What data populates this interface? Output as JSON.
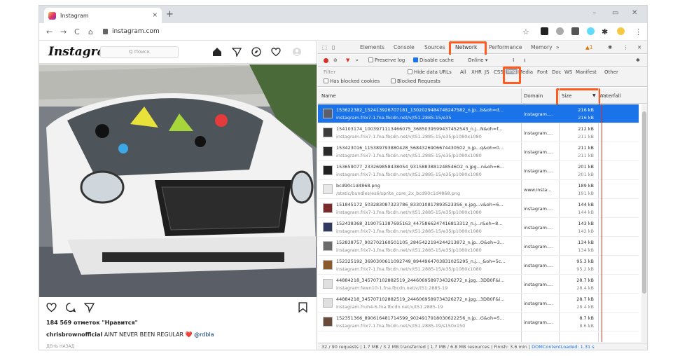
{
  "browser": {
    "tab_title": "Instagram",
    "tab_close": "×",
    "new_tab": "+",
    "url": "instagram.com",
    "win_minimize": "–",
    "win_restore": "▭",
    "win_close": "✕"
  },
  "instagram": {
    "logo": "Instagram",
    "search_placeholder": "Q Поиск",
    "likes": "184 569 отметок \"Нравится\"",
    "caption_user": "chrisbrownofficial",
    "caption_text": " AINT NEVER BEEN REGULAR ❤️ ",
    "caption_mention": "@rdbla",
    "time_ago": "ДЕНЬ НАЗАД"
  },
  "devtools": {
    "tabs": [
      "Elements",
      "Console",
      "Sources",
      "Network",
      "Performance",
      "Memory",
      "»"
    ],
    "warning_count": "▲1",
    "preserve_log": "Preserve log",
    "disable_cache": "Disable cache",
    "online": "Online",
    "filter_placeholder": "Filter",
    "hide_data_urls": "Hide data URLs",
    "type_filters": [
      "All",
      "XHR",
      "JS",
      "CSS",
      "Img",
      "Media",
      "Font",
      "Doc",
      "WS",
      "Manifest",
      "Other"
    ],
    "has_blocked_cookies": "Has blocked cookies",
    "blocked_requests": "Blocked Requests",
    "columns": {
      "name": "Name",
      "domain": "Domain",
      "size": "Size",
      "sort": "▼",
      "waterfall": "Waterfall"
    },
    "rows": [
      {
        "n1": "153622382_152413926707181_1302029484748247582_n.jp...b&oh=d...",
        "n2": "instagram.frix7-1.fna.fbcdn.net/v/t51.2885-15/e35",
        "dom": "instagram....",
        "s1": "216 kB",
        "s2": "216 kB",
        "thumb": "#5b5f6b",
        "selected": true
      },
      {
        "n1": "154103174_1003971113466075_3685039599437452543_n.j...N&oh=f...",
        "n2": "instagram.frix7-1.fna.fbcdn.net/v/t51.2885-15/e35/p1080x1080",
        "dom": "instagram....",
        "s1": "212 kB",
        "s2": "211 kB",
        "thumb": "#3c3c3c"
      },
      {
        "n1": "153423016_115389793880428_5684326906674430502_n.jp...q&oh=0...",
        "n2": "instagram.frix7-1.fna.fbcdn.net/v/t51.2885-15/e35/p1080x1080",
        "dom": "instagram....",
        "s1": "211 kB",
        "s2": "211 kB",
        "thumb": "#2a2a2a"
      },
      {
        "n1": "153659077_233269858438054_9315883881248546O2_n.jpg...n&oh=6...",
        "n2": "instagram.frix7-1.fna.fbcdn.net/v/t51.2885-15/e35/p1080x1080",
        "dom": "instagram....",
        "s1": "201 kB",
        "s2": "201 kB",
        "thumb": "#222222"
      },
      {
        "n1": "bcd90c1d4868.png",
        "n2": "/static/bundles/es6/sprite_core_2x_bcd90c1d4868.png",
        "dom": "www.insta...",
        "s1": "189 kB",
        "s2": "191 kB",
        "thumb": "#e8e8e8"
      },
      {
        "n1": "151845172_503283087323786_8330108178935233S6_n.jpg...v&oh=6...",
        "n2": "instagram.frix7-1.fna.fbcdn.net/v/t51.2885-15/e35/p1080x1080",
        "dom": "instagram....",
        "s1": "144 kB",
        "s2": "144 kB",
        "thumb": "#7a2a2a"
      },
      {
        "n1": "152438368_3190751387695163_4475866247416813312_n.j...r&oh=8...",
        "n2": "instagram.frix7-1.fna.fbcdn.net/v/t51.2885-15/e35/p1080x1080",
        "dom": "instagram....",
        "s1": "143 kB",
        "s2": "142 kB",
        "thumb": "#303a60"
      },
      {
        "n1": "152838757_902702160501105_2845422194244213872_n.jp...O&oh=3...",
        "n2": "instagram.frix7-1.fna.fbcdn.net/v/t51.2885-15/e35/p1080x1080",
        "dom": "instagram....",
        "s1": "134 kB",
        "s2": "134 kB",
        "thumb": "#6a6a6a"
      },
      {
        "n1": "152325192_3690300611092749_8944964703831025295_n.j..._&oh=5c...",
        "n2": "instagram.frix7-1.fna.fbcdn.net/v/t51.2885-15/e35/p1080x1080",
        "dom": "instagram....",
        "s1": "95.3 kB",
        "s2": "95.2 kB",
        "thumb": "#8a5a2a"
      },
      {
        "n1": "44884218_345707102882519_2446069589734326272_n.jpg...3DB0F&i...",
        "n2": "instagram.fewn10-1.fna.fbcdn.net/v/t51.2885-19",
        "dom": "instagram....",
        "s1": "28.7 kB",
        "s2": "28.4 kB",
        "thumb": "#e0e0e0"
      },
      {
        "n1": "44884218_345707102882519_2446069589734326272_n.jpg...3DB0F&i...",
        "n2": "instagram.fruh4-6.fna.fbcdn.net/v/t51.2885-19",
        "dom": "instagram....",
        "s1": "28.7 kB",
        "s2": "28.4 kB",
        "thumb": "#e0e0e0"
      },
      {
        "n1": "152351366_890616481714599_9024917918030622256_n.jp...G&oh=5...",
        "n2": "instagram.frix7-1.fna.fbcdn.net/v/t51.2885-19/s150x150",
        "dom": "instagram....",
        "s1": "8.7 kB",
        "s2": "8.6 kB",
        "thumb": "#6a4a3a"
      }
    ],
    "status_main": "32 / 90 requests  |  1.7 MB / 3.2 MB transferred  |  1.7 MB / 6.8 MB resources  |  Finish: 3.6 min  |  ",
    "status_dcl": "DOMContentLoaded: 1.31 s"
  },
  "colors": {
    "accent": "#1a73e8",
    "highlight": "#ff5a1f",
    "record": "#d93025"
  }
}
